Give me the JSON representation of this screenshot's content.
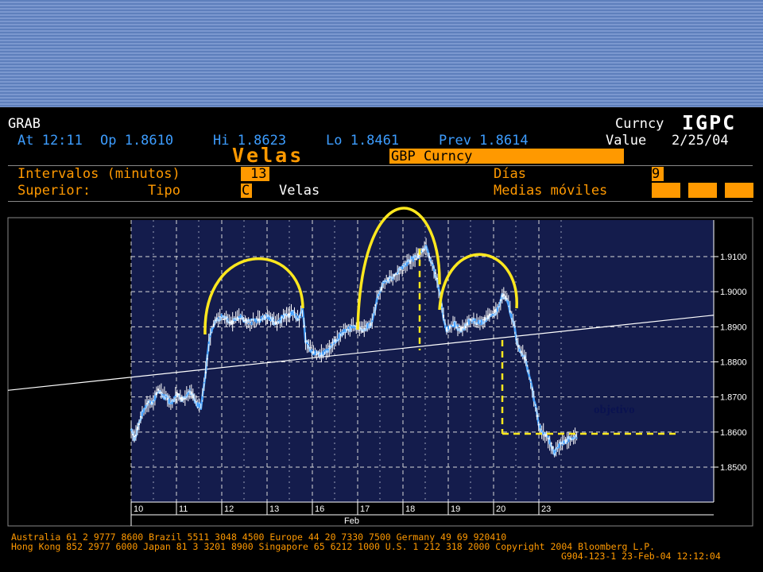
{
  "header": {
    "screen_code": "GRAB",
    "quote_line": {
      "at": "At 12:11",
      "op": "Op 1.8610",
      "hi": "Hi 1.8623",
      "lo": "Lo 1.8461",
      "prev": "Prev 1.8614"
    },
    "market": "Curncy",
    "function": "IGPC",
    "value_label": "Value",
    "value_date": "2/25/04",
    "chart_title": "Velas",
    "security": "GBP Curncy"
  },
  "params": {
    "interval_label": "Intervalos (minutos)",
    "interval_value": "13",
    "days_label": "Días",
    "days_value": "9",
    "upper_label": "Superior:",
    "type_label": "Tipo",
    "type_code": "C",
    "type_value": "Velas",
    "ma_label": "Medias móviles"
  },
  "chart_data": {
    "type": "candlestick",
    "title": "",
    "ylim": [
      1.8435,
      1.9175
    ],
    "y_ticks": [
      "1.9100",
      "1.9000",
      "1.8900",
      "1.8800",
      "1.8700",
      "1.8600",
      "1.8500"
    ],
    "x_ticks": [
      "10",
      "11",
      "12",
      "13",
      "16",
      "17",
      "18",
      "19",
      "20",
      "23"
    ],
    "x_month_label": "Feb",
    "xlim": [
      0,
      10
    ],
    "price_path": [
      [
        0.0,
        1.861
      ],
      [
        0.08,
        1.858
      ],
      [
        0.2,
        1.864
      ],
      [
        0.35,
        1.868
      ],
      [
        0.5,
        1.869
      ],
      [
        0.6,
        1.872
      ],
      [
        0.75,
        1.87
      ],
      [
        0.9,
        1.868
      ],
      [
        1.0,
        1.871
      ],
      [
        1.15,
        1.869
      ],
      [
        1.3,
        1.872
      ],
      [
        1.45,
        1.868
      ],
      [
        1.55,
        1.867
      ],
      [
        1.65,
        1.878
      ],
      [
        1.72,
        1.886
      ],
      [
        1.85,
        1.892
      ],
      [
        2.0,
        1.893
      ],
      [
        2.2,
        1.891
      ],
      [
        2.4,
        1.893
      ],
      [
        2.6,
        1.891
      ],
      [
        2.8,
        1.892
      ],
      [
        3.0,
        1.893
      ],
      [
        3.2,
        1.891
      ],
      [
        3.4,
        1.893
      ],
      [
        3.6,
        1.894
      ],
      [
        3.7,
        1.892
      ],
      [
        3.78,
        1.895
      ],
      [
        3.85,
        1.886
      ],
      [
        3.95,
        1.884
      ],
      [
        4.1,
        1.882
      ],
      [
        4.3,
        1.883
      ],
      [
        4.5,
        1.886
      ],
      [
        4.7,
        1.889
      ],
      [
        4.9,
        1.89
      ],
      [
        5.1,
        1.889
      ],
      [
        5.3,
        1.891
      ],
      [
        5.45,
        1.899
      ],
      [
        5.6,
        1.903
      ],
      [
        5.8,
        1.904
      ],
      [
        6.0,
        1.907
      ],
      [
        6.2,
        1.909
      ],
      [
        6.4,
        1.911
      ],
      [
        6.5,
        1.913
      ],
      [
        6.6,
        1.909
      ],
      [
        6.75,
        1.904
      ],
      [
        6.85,
        1.896
      ],
      [
        6.95,
        1.889
      ],
      [
        7.1,
        1.891
      ],
      [
        7.3,
        1.889
      ],
      [
        7.5,
        1.892
      ],
      [
        7.7,
        1.891
      ],
      [
        7.9,
        1.893
      ],
      [
        8.1,
        1.895
      ],
      [
        8.2,
        1.899
      ],
      [
        8.3,
        1.898
      ],
      [
        8.42,
        1.892
      ],
      [
        8.55,
        1.884
      ],
      [
        8.7,
        1.881
      ],
      [
        8.85,
        1.872
      ],
      [
        9.0,
        1.862
      ],
      [
        9.15,
        1.859
      ],
      [
        9.25,
        1.857
      ],
      [
        9.35,
        1.854
      ],
      [
        9.5,
        1.857
      ],
      [
        9.7,
        1.858
      ],
      [
        9.85,
        1.859
      ]
    ],
    "trendline": {
      "start": [
        -3.0,
        1.8715
      ],
      "end": [
        13.0,
        1.8935
      ]
    },
    "annotation": "objetivo",
    "target_level": 1.8595
  },
  "footer": {
    "line1": "Australia 61 2 9777 8600          Brazil 5511 3048 4500          Europe 44 20 7330 7500          Germany 49 69 920410",
    "line2": "Hong Kong 852 2977 6000 Japan 81 3 3201 8900 Singapore 65 6212 1000 U.S. 1 212 318 2000 Copyright 2004 Bloomberg L.P.",
    "line3": "G904-123-1 23-Feb-04 12:12:04"
  },
  "colors": {
    "orange": "#ff9900",
    "blue_text": "#3d9dff",
    "plot_bg": "#141c4c",
    "candle": "#4aa3ff",
    "annotation_yellow": "#ffe81e"
  }
}
